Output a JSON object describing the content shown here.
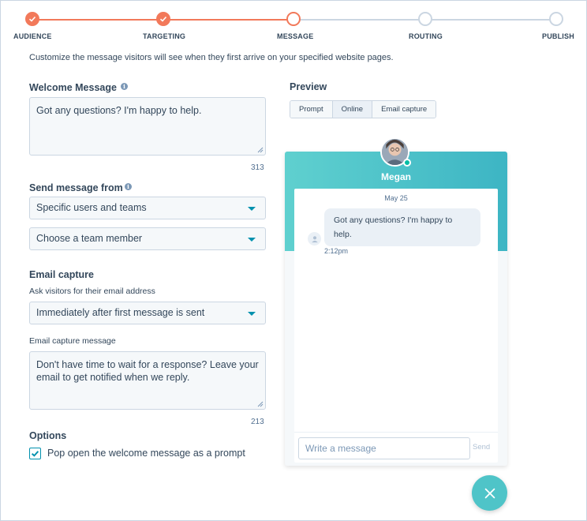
{
  "stepper": {
    "steps": [
      {
        "label": "AUDIENCE",
        "state": "done"
      },
      {
        "label": "TARGETING",
        "state": "done"
      },
      {
        "label": "MESSAGE",
        "state": "current"
      },
      {
        "label": "ROUTING",
        "state": "todo"
      },
      {
        "label": "PUBLISH",
        "state": "todo"
      }
    ]
  },
  "intro_text": "Customize the message visitors will see when they first arrive on your specified website pages.",
  "welcome": {
    "title": "Welcome Message",
    "value": "Got any questions? I'm happy to help.",
    "counter": "313"
  },
  "send_from": {
    "title": "Send message from",
    "select_1": "Specific users and teams",
    "select_2": "Choose a team member"
  },
  "email_capture": {
    "title": "Email capture",
    "ask_label": "Ask visitors for their email address",
    "timing_select": "Immediately after first message is sent",
    "message_label": "Email capture message",
    "message_value": "Don't have time to wait for a response? Leave your email to get notified when we reply.",
    "counter": "213"
  },
  "options": {
    "title": "Options",
    "popup_label": "Pop open the welcome message as a prompt",
    "popup_checked": true
  },
  "preview": {
    "title": "Preview",
    "tabs": [
      "Prompt",
      "Online",
      "Email capture"
    ],
    "active_tab": "Online",
    "agent_name": "Megan",
    "date": "May 25",
    "message": "Got any questions? I'm happy to help.",
    "time": "2:12pm",
    "composer_placeholder": "Write a message",
    "send_label": "Send"
  },
  "colors": {
    "accent": "#f2795a",
    "teal": "#4fc4c8",
    "link": "#0091ae"
  }
}
